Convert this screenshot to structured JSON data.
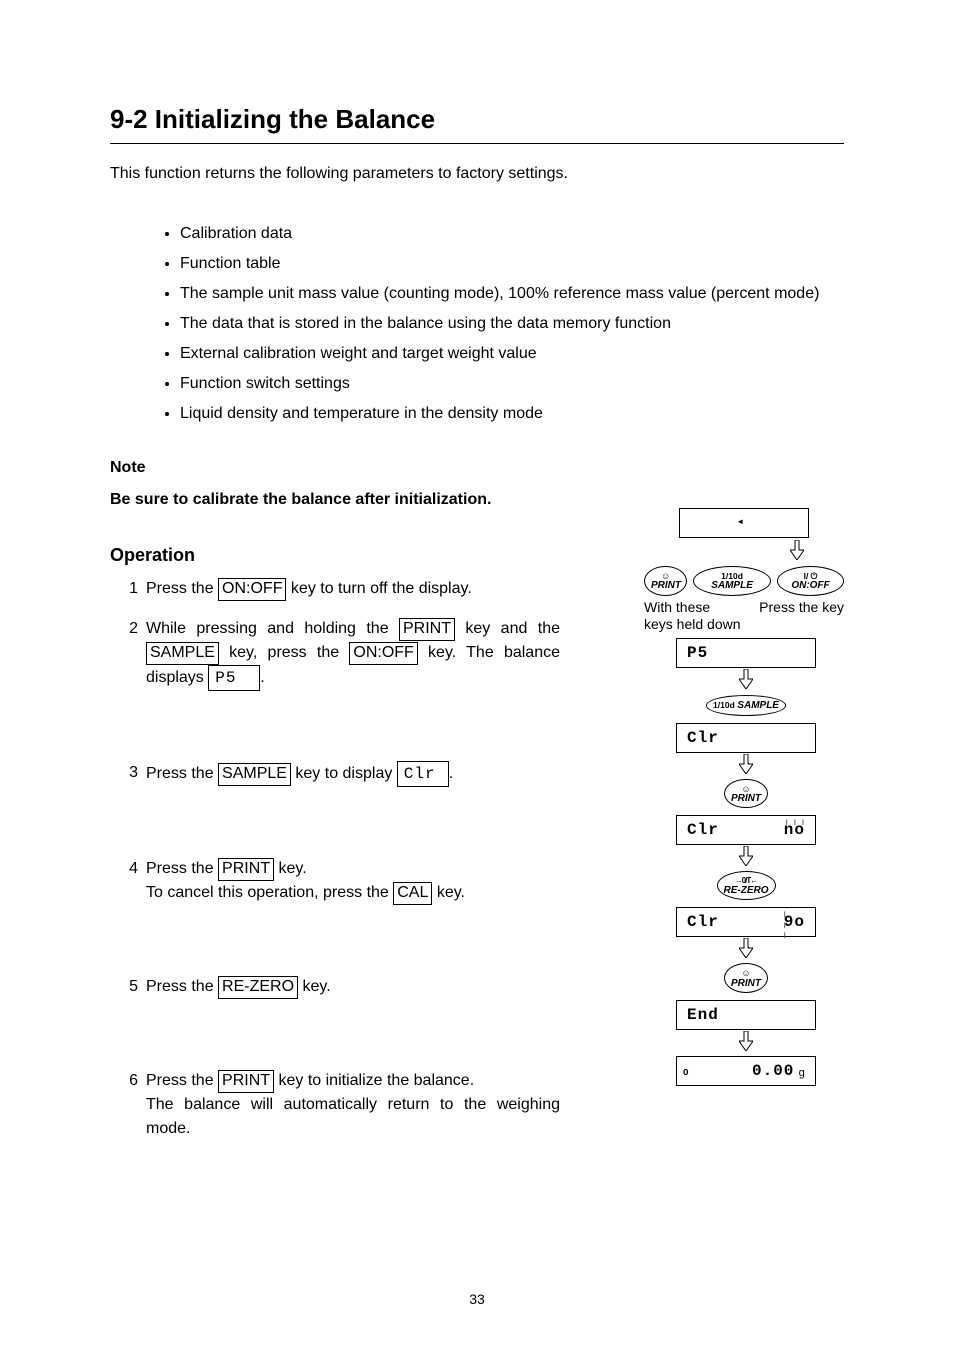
{
  "title": "9-2  Initializing the Balance",
  "intro": "This function returns the following parameters to factory settings.",
  "bullets": [
    "Calibration data",
    "Function table",
    "The sample unit mass value (counting mode), 100% reference mass value (percent mode)",
    "The data that is stored in the balance using the data memory function",
    "External calibration weight and target weight value",
    "Function switch settings",
    "Liquid density and temperature in the density mode"
  ],
  "note": {
    "head": "Note",
    "text": "Be sure to calibrate the balance after initialization."
  },
  "op_head": "Operation",
  "steps": {
    "s1": {
      "num": "1",
      "a": "Press the ",
      "k1": "ON:OFF",
      "b": " key to turn off the display."
    },
    "s2": {
      "num": "2",
      "a": "While pressing and holding the ",
      "k1": "PRINT",
      "b": " key and the ",
      "k2": "SAMPLE",
      "c": " key, press the ",
      "k3": "ON:OFF",
      "d": " key. The balance displays ",
      "seg": " P5    ",
      "e": "."
    },
    "s3": {
      "num": "3",
      "a": "Press the ",
      "k1": "SAMPLE",
      "b": " key to display ",
      "seg": " Clr  ",
      "c": "."
    },
    "s4": {
      "num": "4",
      "a": "Press the ",
      "k1": "PRINT",
      "b": " key.",
      "line2a": "To cancel this operation, press the ",
      "k2": "CAL",
      "line2b": " key."
    },
    "s5": {
      "num": "5",
      "a": "Press the ",
      "k1": "RE-ZERO",
      "b": " key."
    },
    "s6": {
      "num": "6",
      "a": "Press the ",
      "k1": "PRINT",
      "b": " key to initialize the balance.",
      "line2": "The balance will automatically return to the weighing mode."
    }
  },
  "keys": {
    "print": {
      "top": "☺",
      "bot": "PRINT"
    },
    "sample": {
      "top": "1/10d",
      "bot": "SAMPLE"
    },
    "onoff": {
      "top": "I/ ⏻",
      "bot": "ON:OFF"
    },
    "rezero": {
      "top": "→0/T←",
      "bot": "RE-ZERO"
    }
  },
  "diag1": {
    "caption_left": "With these keys held down",
    "caption_right": "Press the key"
  },
  "flow": {
    "d1": "P5",
    "d2": "Clr",
    "d3_l": "Clr",
    "d3_r": "no",
    "d4_l": "Clr",
    "d4_r": "9o",
    "d5": "End",
    "d6": "0.00",
    "d6_unit": "g"
  },
  "page": "33"
}
